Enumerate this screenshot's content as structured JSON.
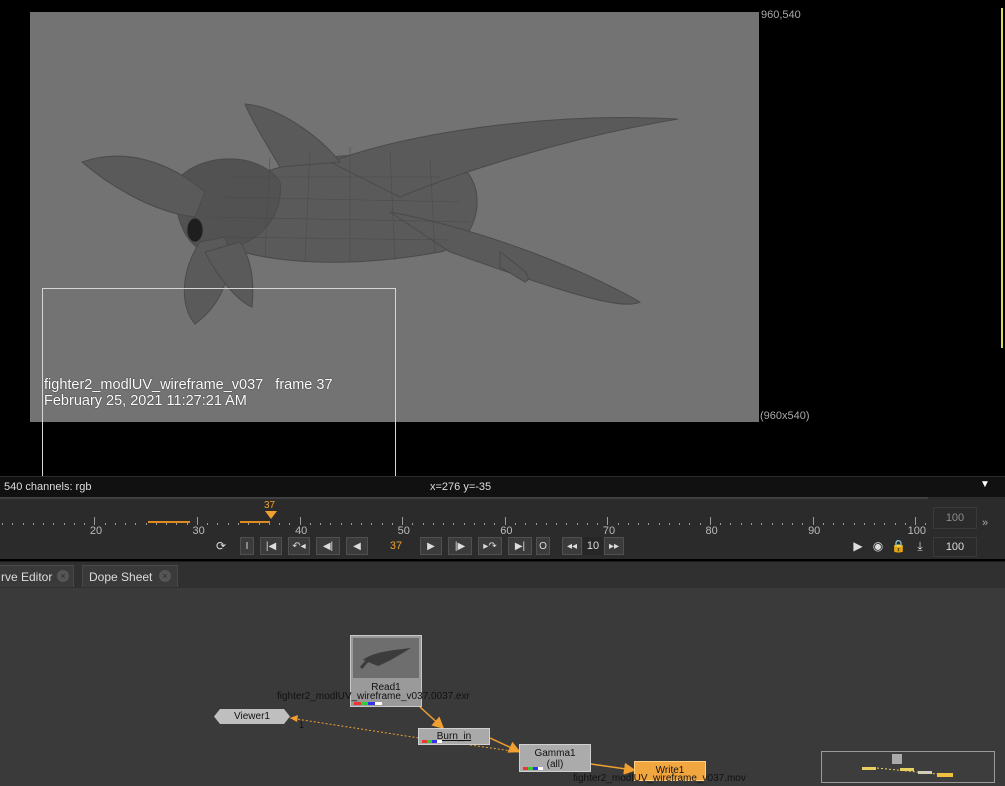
{
  "viewer": {
    "format_top_right": "960,540",
    "format_bottom_right": "(960x540)",
    "burnin_line1": "fighter2_modlUV_wireframe_v037   frame 37",
    "burnin_line2": "February 25, 2021 11:27:21 AM"
  },
  "infobar": {
    "left": "540 channels: rgb",
    "coords": "x=276 y=-35"
  },
  "timeline": {
    "current_frame_marker": "37",
    "tick_labels": [
      "20",
      "30",
      "40",
      "50",
      "60",
      "70",
      "80",
      "90",
      "100"
    ],
    "range_end_top": "100",
    "frame_field": "37",
    "increment_field": "10",
    "end_field": "100",
    "btn_in": "I",
    "btn_out": "O"
  },
  "tabs": [
    {
      "label": "rve Editor"
    },
    {
      "label": "Dope Sheet"
    }
  ],
  "nodegraph": {
    "read_label": "Read1",
    "read_file": "fighter2_modlUV_wireframe_v037.0037.exr",
    "viewer_label": "Viewer1",
    "viewer_input": "1",
    "burn_label": "Burn_in",
    "gamma_label": "Gamma1",
    "gamma_sub": "(all)",
    "write_label": "Write1",
    "write_file": "fighter2_modlUV_wireframe_v037.mov"
  },
  "colors": {
    "accent_orange": "#f0a030",
    "write_node": "#f2a640"
  }
}
